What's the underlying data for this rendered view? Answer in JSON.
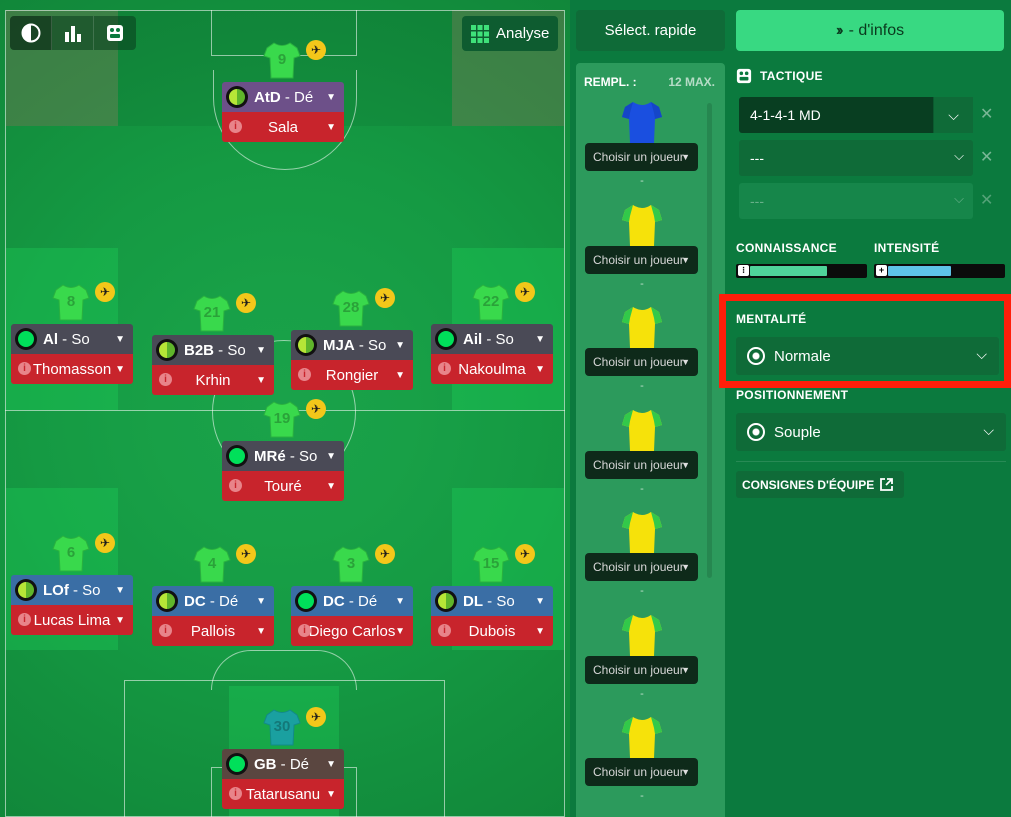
{
  "toolbar": {
    "analyse_label": "Analyse",
    "quick_select_label": "Sélect. rapide",
    "more_info_label": "- d'infos"
  },
  "players": [
    {
      "id": "atd",
      "number": "9",
      "role": "AtD",
      "duty": "Dé",
      "name": "Sala",
      "role_color": "#6d5089",
      "ring": "half"
    },
    {
      "id": "al",
      "number": "8",
      "role": "Al",
      "duty": "So",
      "name": "Thomasson",
      "role_color": "#4a4a56",
      "ring": "full"
    },
    {
      "id": "b2b",
      "number": "21",
      "role": "B2B",
      "duty": "So",
      "name": "Krhin",
      "role_color": "#4a4a56",
      "ring": "half"
    },
    {
      "id": "mja",
      "number": "28",
      "role": "MJA",
      "duty": "So",
      "name": "Rongier",
      "role_color": "#4a4a56",
      "ring": "half"
    },
    {
      "id": "ail",
      "number": "22",
      "role": "Ail",
      "duty": "So",
      "name": "Nakoulma",
      "role_color": "#4a4a56",
      "ring": "full"
    },
    {
      "id": "mre",
      "number": "19",
      "role": "MRé",
      "duty": "So",
      "name": "Touré",
      "role_color": "#4a4a56",
      "ring": "full"
    },
    {
      "id": "lof",
      "number": "6",
      "role": "LOf",
      "duty": "So",
      "name": "Lucas Lima",
      "role_color": "#3a6ea5",
      "ring": "half"
    },
    {
      "id": "dc1",
      "number": "4",
      "role": "DC",
      "duty": "Dé",
      "name": "Pallois",
      "role_color": "#3a6ea5",
      "ring": "half"
    },
    {
      "id": "dc2",
      "number": "3",
      "role": "DC",
      "duty": "Dé",
      "name": "Diego Carlos",
      "role_color": "#3a6ea5",
      "ring": "full"
    },
    {
      "id": "dl",
      "number": "15",
      "role": "DL",
      "duty": "So",
      "name": "Dubois",
      "role_color": "#3a6ea5",
      "ring": "half"
    },
    {
      "id": "gb",
      "number": "30",
      "role": "GB",
      "duty": "Dé",
      "name": "Tatarusanu",
      "role_color": "#5a4640",
      "ring": "full"
    }
  ],
  "subs": {
    "header": "REMPL. :",
    "max_label": "12 MAX.",
    "slots": [
      {
        "placeholder": "Choisir un joueur",
        "caption": "-",
        "kit": "goalkeeper"
      },
      {
        "placeholder": "Choisir un joueur",
        "caption": "-",
        "kit": "outfield"
      },
      {
        "placeholder": "Choisir un joueur",
        "caption": "-",
        "kit": "outfield"
      },
      {
        "placeholder": "Choisir un joueur",
        "caption": "-",
        "kit": "outfield"
      },
      {
        "placeholder": "Choisir un joueur",
        "caption": "-",
        "kit": "outfield"
      },
      {
        "placeholder": "Choisir un joueur",
        "caption": "-",
        "kit": "outfield"
      },
      {
        "placeholder": "Choisir un joueur",
        "caption": "-",
        "kit": "outfield"
      }
    ]
  },
  "tactics": {
    "section_label": "TACTIQUE",
    "slot1": "4-1-4-1 MD",
    "slot2": "---",
    "slot3": "---",
    "familiarity_label": "CONNAISSANCE",
    "intensity_label": "INTENSITÉ",
    "familiarity_level": 0.67,
    "intensity_level": 0.55,
    "mentality_label": "MENTALITÉ",
    "mentality_value": "Normale",
    "positioning_label": "POSITIONNEMENT",
    "positioning_value": "Souple",
    "team_instructions_label": "CONSIGNES D'ÉQUIPE"
  },
  "colors": {
    "accent_green": "#38d982",
    "dark_green": "#0f6b38",
    "highlight_red": "#ff1e0a",
    "name_red": "#c8242c"
  }
}
